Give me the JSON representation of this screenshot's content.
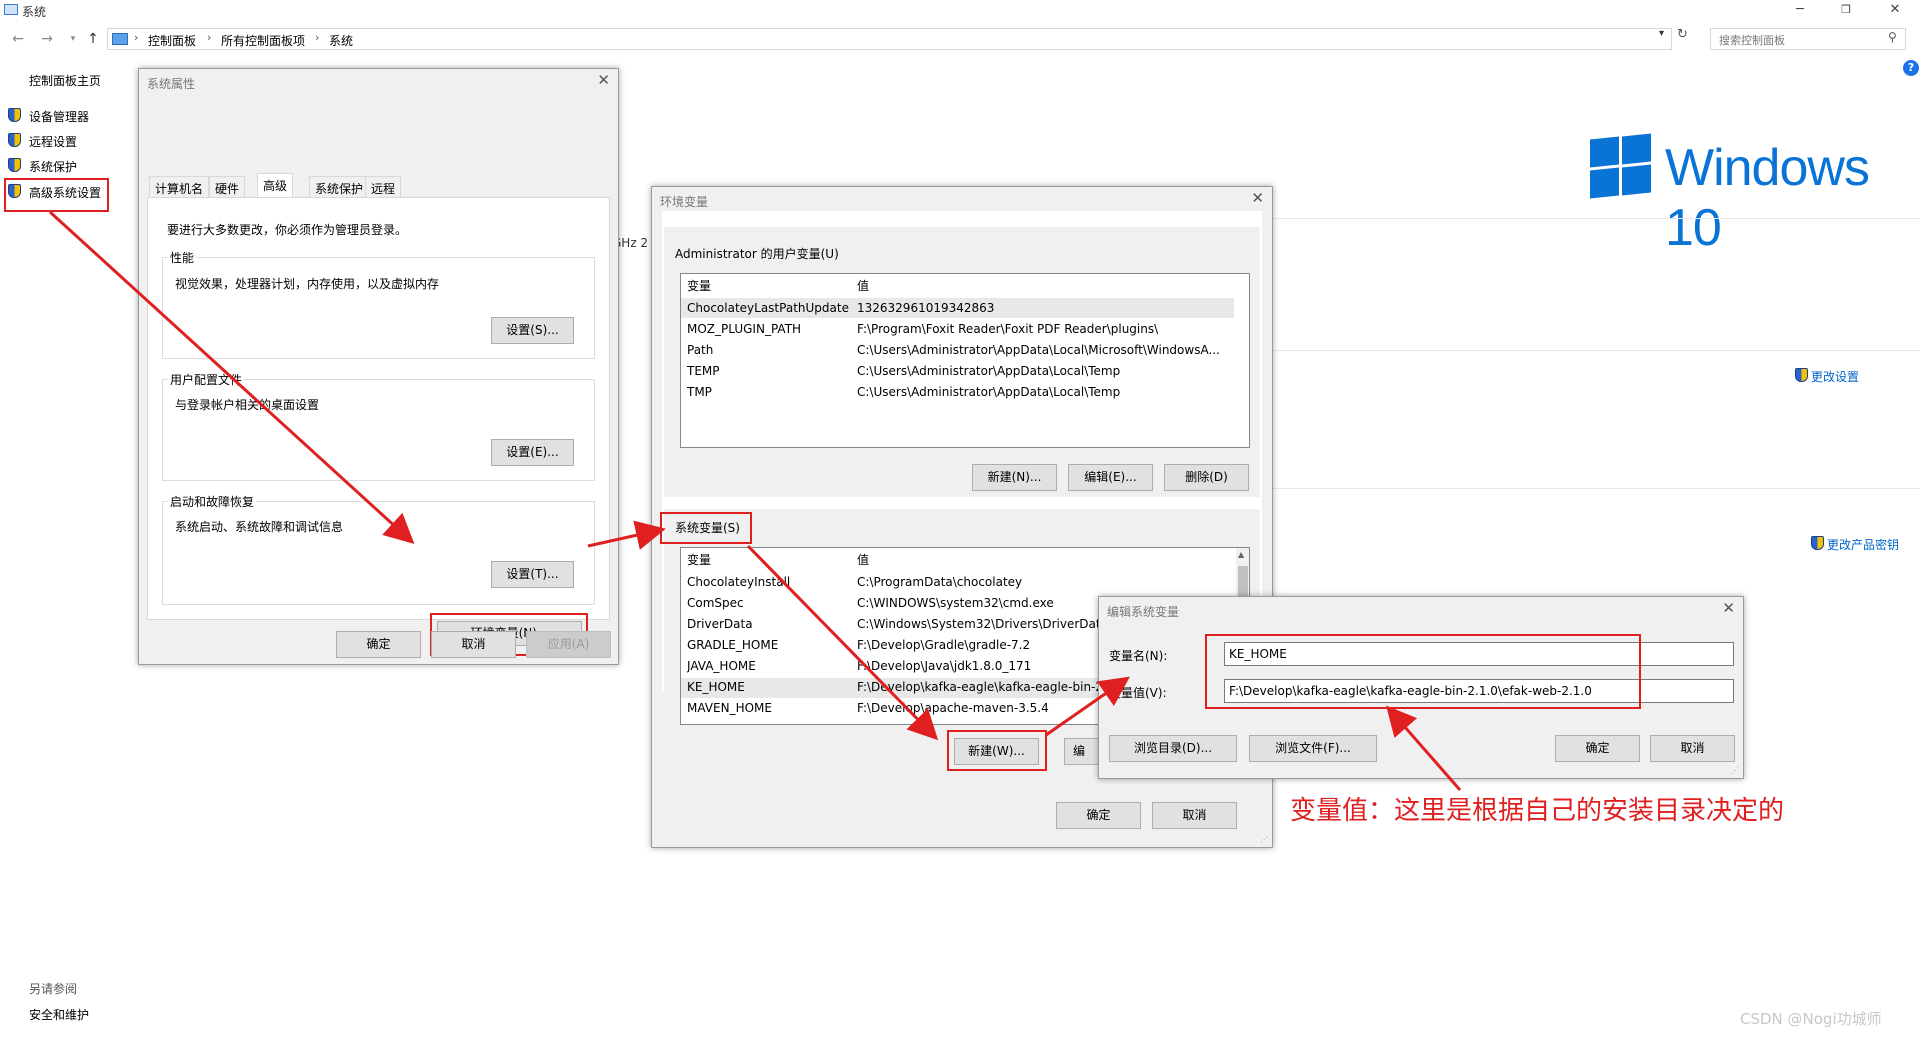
{
  "window": {
    "title": "系统"
  },
  "address": {
    "crumbs": [
      "控制面板",
      "所有控制面板项",
      "系统"
    ],
    "search_placeholder": "搜索控制面板"
  },
  "left_panel": {
    "home": "控制面板主页",
    "links": [
      "设备管理器",
      "远程设置",
      "系统保护",
      "高级系统设置"
    ],
    "see_also_title": "另请参阅",
    "see_also_link": "安全和维护"
  },
  "brand": {
    "logo_text": "Windows 10",
    "accent": "#0a74d6"
  },
  "right_links": {
    "change_settings": "更改设置",
    "change_key": "更改产品密钥",
    "partial_cpu": "GHz  2"
  },
  "sys_props": {
    "title": "系统属性",
    "tabs": [
      "计算机名",
      "硬件",
      "高级",
      "系统保护",
      "远程"
    ],
    "active_tab": "高级",
    "admin_note": "要进行大多数更改，你必须作为管理员登录。",
    "performance": {
      "label": "性能",
      "desc": "视觉效果，处理器计划，内存使用，以及虚拟内存",
      "button": "设置(S)..."
    },
    "user_profile": {
      "label": "用户配置文件",
      "desc": "与登录帐户相关的桌面设置",
      "button": "设置(E)..."
    },
    "startup": {
      "label": "启动和故障恢复",
      "desc": "系统启动、系统故障和调试信息",
      "button": "设置(T)..."
    },
    "env_button": "环境变量(N)...",
    "ok": "确定",
    "cancel": "取消",
    "apply": "应用(A)"
  },
  "env_vars": {
    "title": "环境变量",
    "user_section": "Administrator 的用户变量(U)",
    "col_var": "变量",
    "col_val": "值",
    "user_vars": [
      {
        "name": "ChocolateyLastPathUpdate",
        "value": "132632961019342863"
      },
      {
        "name": "MOZ_PLUGIN_PATH",
        "value": "F:\\Program\\Foxit Reader\\Foxit PDF Reader\\plugins\\"
      },
      {
        "name": "Path",
        "value": "C:\\Users\\Administrator\\AppData\\Local\\Microsoft\\WindowsA..."
      },
      {
        "name": "TEMP",
        "value": "C:\\Users\\Administrator\\AppData\\Local\\Temp"
      },
      {
        "name": "TMP",
        "value": "C:\\Users\\Administrator\\AppData\\Local\\Temp"
      }
    ],
    "user_buttons": [
      "新建(N)...",
      "编辑(E)...",
      "删除(D)"
    ],
    "sys_section": "系统变量(S)",
    "sys_vars": [
      {
        "name": "ChocolateyInstall",
        "value": "C:\\ProgramData\\chocolatey"
      },
      {
        "name": "ComSpec",
        "value": "C:\\WINDOWS\\system32\\cmd.exe"
      },
      {
        "name": "DriverData",
        "value": "C:\\Windows\\System32\\Drivers\\DriverData"
      },
      {
        "name": "GRADLE_HOME",
        "value": "F:\\Develop\\Gradle\\gradle-7.2"
      },
      {
        "name": "JAVA_HOME",
        "value": "F:\\Develop\\Java\\jdk1.8.0_171"
      },
      {
        "name": "KE_HOME",
        "value": "F:\\Develop\\kafka-eagle\\kafka-eagle-bin-2.1.0"
      },
      {
        "name": "MAVEN_HOME",
        "value": "F:\\Develop\\apache-maven-3.5.4"
      }
    ],
    "sys_buttons": [
      "新建(W)...",
      "编"
    ],
    "ok": "确定",
    "cancel": "取消"
  },
  "edit_var": {
    "title": "编辑系统变量",
    "name_label": "变量名(N):",
    "value_label": "变量值(V):",
    "name_value": "KE_HOME",
    "value_value": "F:\\Develop\\kafka-eagle\\kafka-eagle-bin-2.1.0\\efak-web-2.1.0",
    "browse_dir": "浏览目录(D)...",
    "browse_file": "浏览文件(F)...",
    "ok": "确定",
    "cancel": "取消"
  },
  "annotation": "变量值：这里是根据自己的安装目录决定的",
  "watermark": "CSDN @Nogi功城师",
  "colors": {
    "highlight_red": "#e02020"
  }
}
